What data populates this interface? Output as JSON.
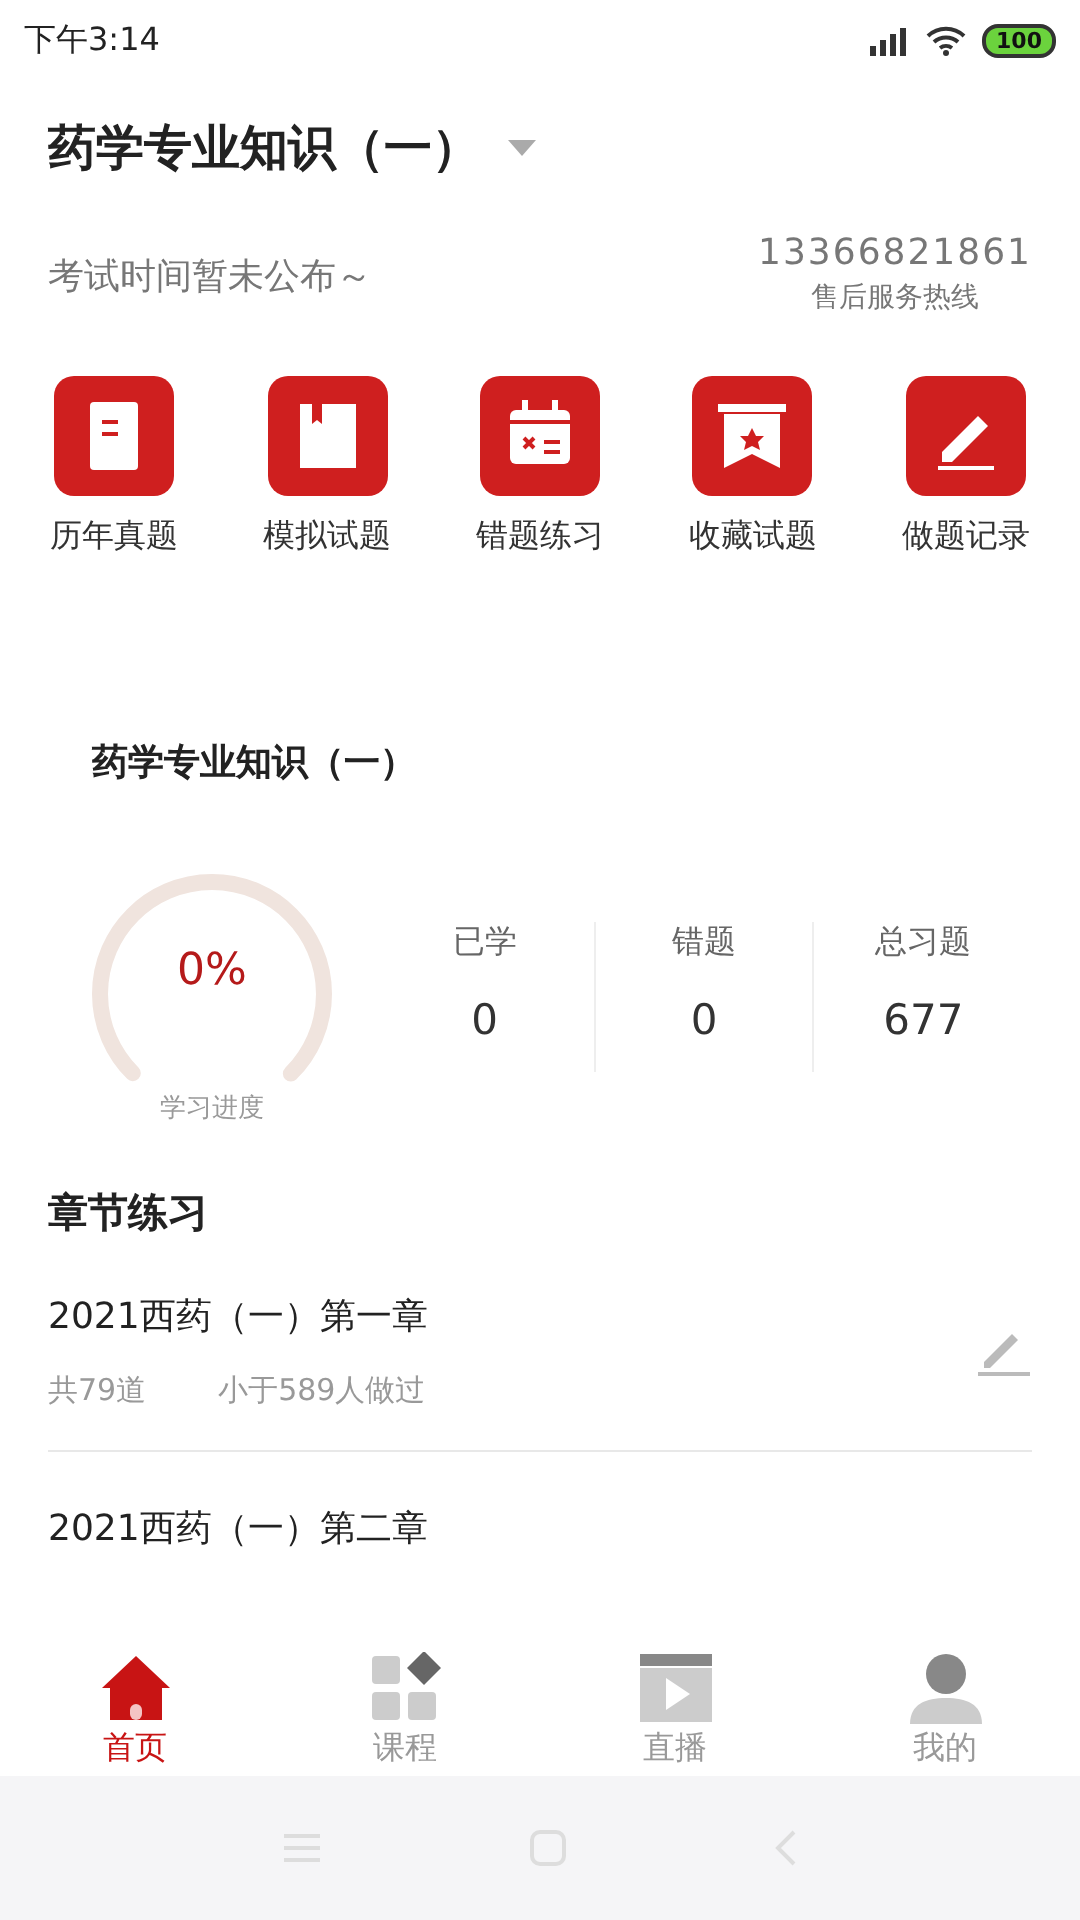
{
  "status_bar": {
    "time": "下午3:14",
    "battery": "100"
  },
  "header": {
    "title": "药学专业知识（一）",
    "subtitle": "考试时间暂未公布～",
    "phone": "13366821861",
    "phone_label": "售后服务热线"
  },
  "shortcuts": [
    {
      "kind": "paper",
      "label": "历年真题"
    },
    {
      "kind": "book",
      "label": "模拟试题"
    },
    {
      "kind": "calendar",
      "label": "错题练习"
    },
    {
      "kind": "banner",
      "label": "收藏试题"
    },
    {
      "kind": "pen",
      "label": "做题记录"
    }
  ],
  "progress": {
    "title": "药学专业知识（一）",
    "percent": "0%",
    "caption": "学习进度",
    "stats": [
      {
        "label": "已学",
        "value": "0"
      },
      {
        "label": "错题",
        "value": "0"
      },
      {
        "label": "总习题",
        "value": "677"
      }
    ]
  },
  "chapters": {
    "title": "章节练习",
    "items": [
      {
        "title": "2021西药（一）第一章",
        "count": "共79道",
        "done": "小于589人做过"
      },
      {
        "title": "2021西药（一）第二章"
      }
    ]
  },
  "tabs": [
    {
      "kind": "home",
      "label": "首页",
      "selected": true
    },
    {
      "kind": "grid",
      "label": "课程",
      "selected": false
    },
    {
      "kind": "video",
      "label": "直播",
      "selected": false
    },
    {
      "kind": "person",
      "label": "我的",
      "selected": false
    }
  ]
}
